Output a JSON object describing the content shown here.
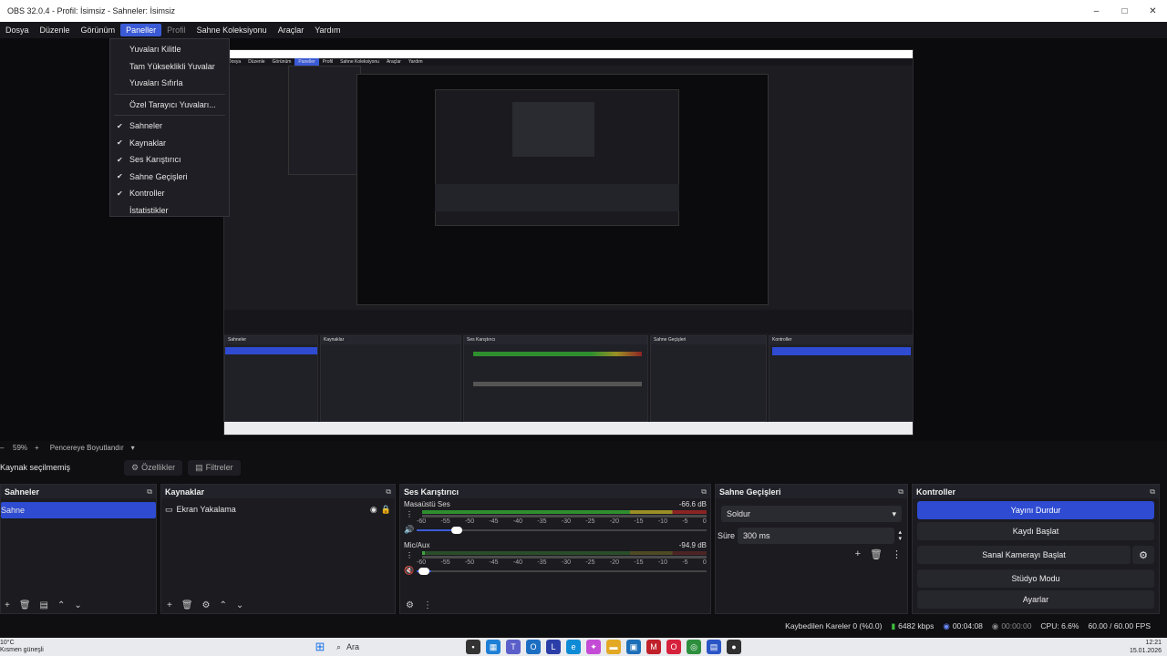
{
  "window": {
    "title": "OBS 32.0.4 - Profil: İsimsiz - Sahneler: İsimsiz",
    "controls": [
      "–",
      "□",
      "✕"
    ]
  },
  "menu": [
    "Dosya",
    "Düzenle",
    "Görünüm",
    "Paneller",
    "Profil",
    "Sahne Koleksiyonu",
    "Araçlar",
    "Yardım"
  ],
  "dropdown": {
    "items": [
      {
        "label": "Yuvaları Kilitle",
        "checked": false
      },
      {
        "label": "Tam Yükseklikli Yuvalar",
        "checked": false
      },
      {
        "label": "Yuvaları Sıfırla",
        "checked": false
      },
      {
        "label": "Özel Tarayıcı Yuvaları...",
        "checked": false
      },
      {
        "label": "Sahneler",
        "checked": true
      },
      {
        "label": "Kaynaklar",
        "checked": true
      },
      {
        "label": "Ses Karıştırıcı",
        "checked": true
      },
      {
        "label": "Sahne Geçişleri",
        "checked": true
      },
      {
        "label": "Kontroller",
        "checked": true
      },
      {
        "label": "İstatistikler",
        "checked": false
      }
    ]
  },
  "zoom": {
    "percent": "59%",
    "mode": "Pencereye Boyutlandır"
  },
  "source_bar": {
    "no_source": "Kaynak seçilmemiş",
    "properties": "Özellikler",
    "filters": "Filtreler"
  },
  "docks": {
    "scenes": {
      "title": "Sahneler",
      "items": [
        "Sahne"
      ]
    },
    "sources": {
      "title": "Kaynaklar",
      "items": [
        "Ekran Yakalama"
      ]
    },
    "mixer": {
      "title": "Ses Karıştırıcı",
      "channels": [
        {
          "name": "Masaüstü Ses",
          "db": "-66.6 dB",
          "level": 0.0
        },
        {
          "name": "Mic/Aux",
          "db": "-94.9 dB",
          "level": 0.0
        }
      ],
      "ticks": [
        "-60",
        "-55",
        "-50",
        "-45",
        "-40",
        "-35",
        "-30",
        "-25",
        "-20",
        "-15",
        "-10",
        "-5",
        "0"
      ]
    },
    "transitions": {
      "title": "Sahne Geçişleri",
      "selected": "Soldur",
      "duration_label": "Süre",
      "duration_value": "300 ms"
    },
    "controls": {
      "title": "Kontroller",
      "buttons": [
        "Yayını Durdur",
        "Kaydı Başlat",
        "Sanal Kamerayı Başlat",
        "Stüdyo Modu",
        "Ayarlar"
      ]
    }
  },
  "status": {
    "dropped": "Kaybedilen Kareler 0 (%0.0)",
    "bitrate": "6482 kbps",
    "stream_time": "00:04:08",
    "rec_time": "00:00:00",
    "cpu": "CPU: 6.6%",
    "fps": "60.00 / 60.00 FPS"
  },
  "taskbar": {
    "weather_temp": "10°C",
    "weather_text": "Kısmen güneşli",
    "search": "Ara",
    "time": "12:21",
    "date": "15.01.2026"
  },
  "colors": {
    "accent": "#2e4bd1",
    "meter_green": "#2f8f2f",
    "meter_yellow": "#9a8f24",
    "meter_red": "#8c2424"
  }
}
